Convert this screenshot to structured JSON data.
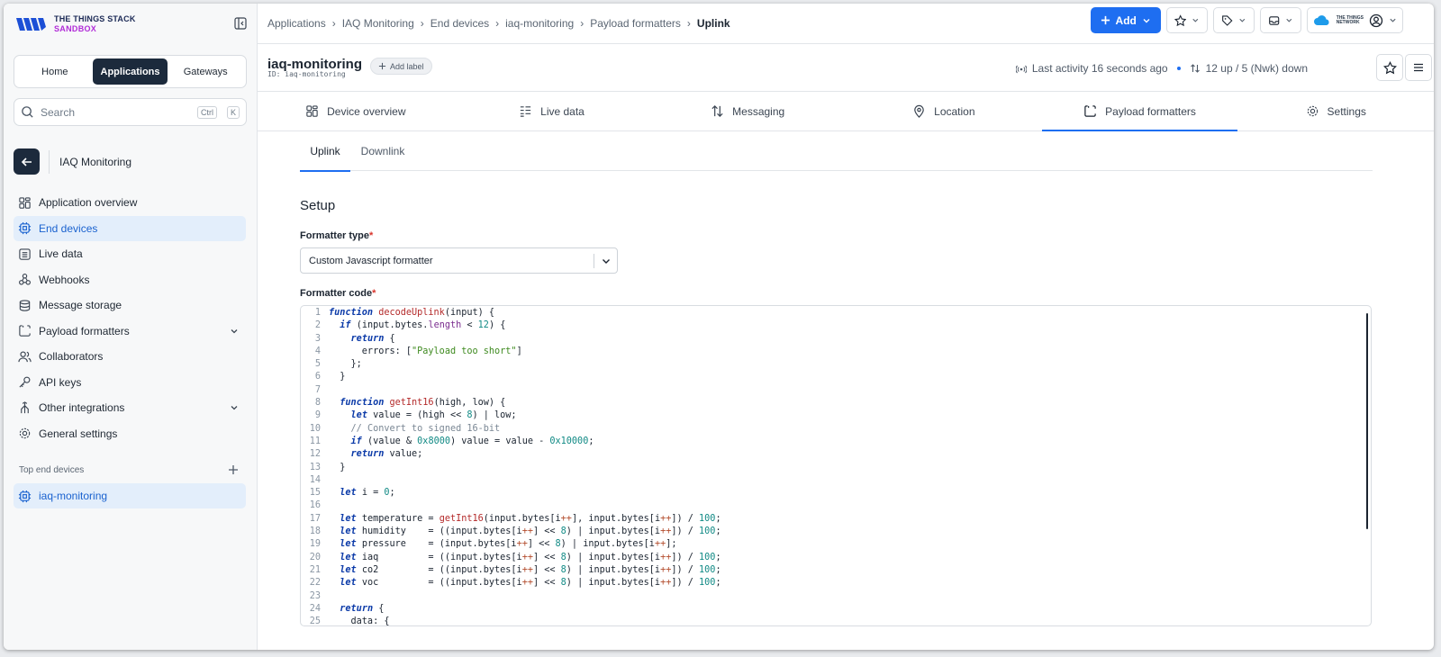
{
  "logo": {
    "line1": "THE THINGS STACK",
    "line2": "SANDBOX"
  },
  "mainnav": [
    {
      "label": "Home",
      "active": false
    },
    {
      "label": "Applications",
      "active": true
    },
    {
      "label": "Gateways",
      "active": false
    }
  ],
  "search": {
    "placeholder": "Search",
    "key1": "Ctrl",
    "key2": "K"
  },
  "app": {
    "name": "IAQ Monitoring"
  },
  "sidebar": {
    "items": [
      {
        "label": "Application overview",
        "icon": "grid-icon",
        "active": false,
        "expandable": false
      },
      {
        "label": "End devices",
        "icon": "chip-icon",
        "active": true,
        "expandable": false
      },
      {
        "label": "Live data",
        "icon": "list-icon",
        "active": false,
        "expandable": false
      },
      {
        "label": "Webhooks",
        "icon": "webhook-icon",
        "active": false,
        "expandable": false
      },
      {
        "label": "Message storage",
        "icon": "database-icon",
        "active": false,
        "expandable": false
      },
      {
        "label": "Payload formatters",
        "icon": "code-icon",
        "active": false,
        "expandable": true
      },
      {
        "label": "Collaborators",
        "icon": "users-icon",
        "active": false,
        "expandable": false
      },
      {
        "label": "API keys",
        "icon": "key-icon",
        "active": false,
        "expandable": false
      },
      {
        "label": "Other integrations",
        "icon": "integrations-icon",
        "active": false,
        "expandable": true
      },
      {
        "label": "General settings",
        "icon": "gear-icon",
        "active": false,
        "expandable": false
      }
    ],
    "section_title": "Top end devices",
    "top_device": "iaq-monitoring"
  },
  "breadcrumbs": [
    "Applications",
    "IAQ Monitoring",
    "End devices",
    "iaq-monitoring",
    "Payload formatters",
    "Uplink"
  ],
  "top_actions": {
    "add_label": "Add",
    "ttn_line1": "THE THINGS",
    "ttn_line2": "NETWORK"
  },
  "device": {
    "title": "iaq-monitoring",
    "id": "ID: iaq-monitoring",
    "add_label": "Add label",
    "last_activity": "Last activity 16 seconds ago",
    "traffic": "12 up / 5 (Nwk) down"
  },
  "tabs": [
    {
      "label": "Device overview",
      "icon": "grid-icon",
      "active": false
    },
    {
      "label": "Live data",
      "icon": "list-icon",
      "active": false
    },
    {
      "label": "Messaging",
      "icon": "arrows-updown-icon",
      "active": false
    },
    {
      "label": "Location",
      "icon": "pin-icon",
      "active": false
    },
    {
      "label": "Payload formatters",
      "icon": "code-icon",
      "active": true
    },
    {
      "label": "Settings",
      "icon": "gear-icon",
      "active": false
    }
  ],
  "subtabs": [
    {
      "label": "Uplink",
      "active": true
    },
    {
      "label": "Downlink",
      "active": false
    }
  ],
  "setup": {
    "title": "Setup",
    "formatter_type_label": "Formatter type",
    "formatter_type_value": "Custom Javascript formatter",
    "formatter_code_label": "Formatter code",
    "required_mark": "*"
  },
  "code_lines": [
    "function decodeUplink(input) {",
    "  if (input.bytes.length < 12) {",
    "    return {",
    "      errors: [\"Payload too short\"]",
    "    };",
    "  }",
    "",
    "  function getInt16(high, low) {",
    "    let value = (high << 8) | low;",
    "    // Convert to signed 16-bit",
    "    if (value & 0x8000) value = value - 0x10000;",
    "    return value;",
    "  }",
    "",
    "  let i = 0;",
    "",
    "  let temperature = getInt16(input.bytes[i++], input.bytes[i++]) / 100;",
    "  let humidity    = ((input.bytes[i++] << 8) | input.bytes[i++]) / 100;",
    "  let pressure    = (input.bytes[i++] << 8) | input.bytes[i++];",
    "  let iaq         = ((input.bytes[i++] << 8) | input.bytes[i++]) / 100;",
    "  let co2         = ((input.bytes[i++] << 8) | input.bytes[i++]) / 100;",
    "  let voc         = ((input.bytes[i++] << 8) | input.bytes[i++]) / 100;",
    "",
    "  return {",
    "    data: {"
  ]
}
